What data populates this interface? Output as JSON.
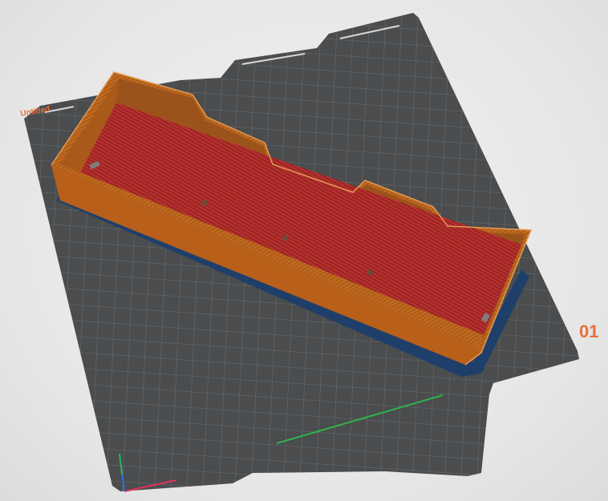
{
  "viewport": {
    "plate_name": "Untitled",
    "plate_number": "01"
  },
  "colors": {
    "background": "#ececec",
    "bed": "#4a4c4e",
    "grid": "#6b6e70",
    "grid_major": "#7c7f81",
    "wall_orange": "#c16a1f",
    "floor_red": "#b5302e",
    "base_blue": "#1f3f6b",
    "axis_x": "#e0315a",
    "axis_y": "#2fb34a",
    "axis_z": "#2d6fe0",
    "label_accent": "#e8703a"
  },
  "icons": [
    "bed-plate-icon",
    "axis-origin-icon"
  ]
}
